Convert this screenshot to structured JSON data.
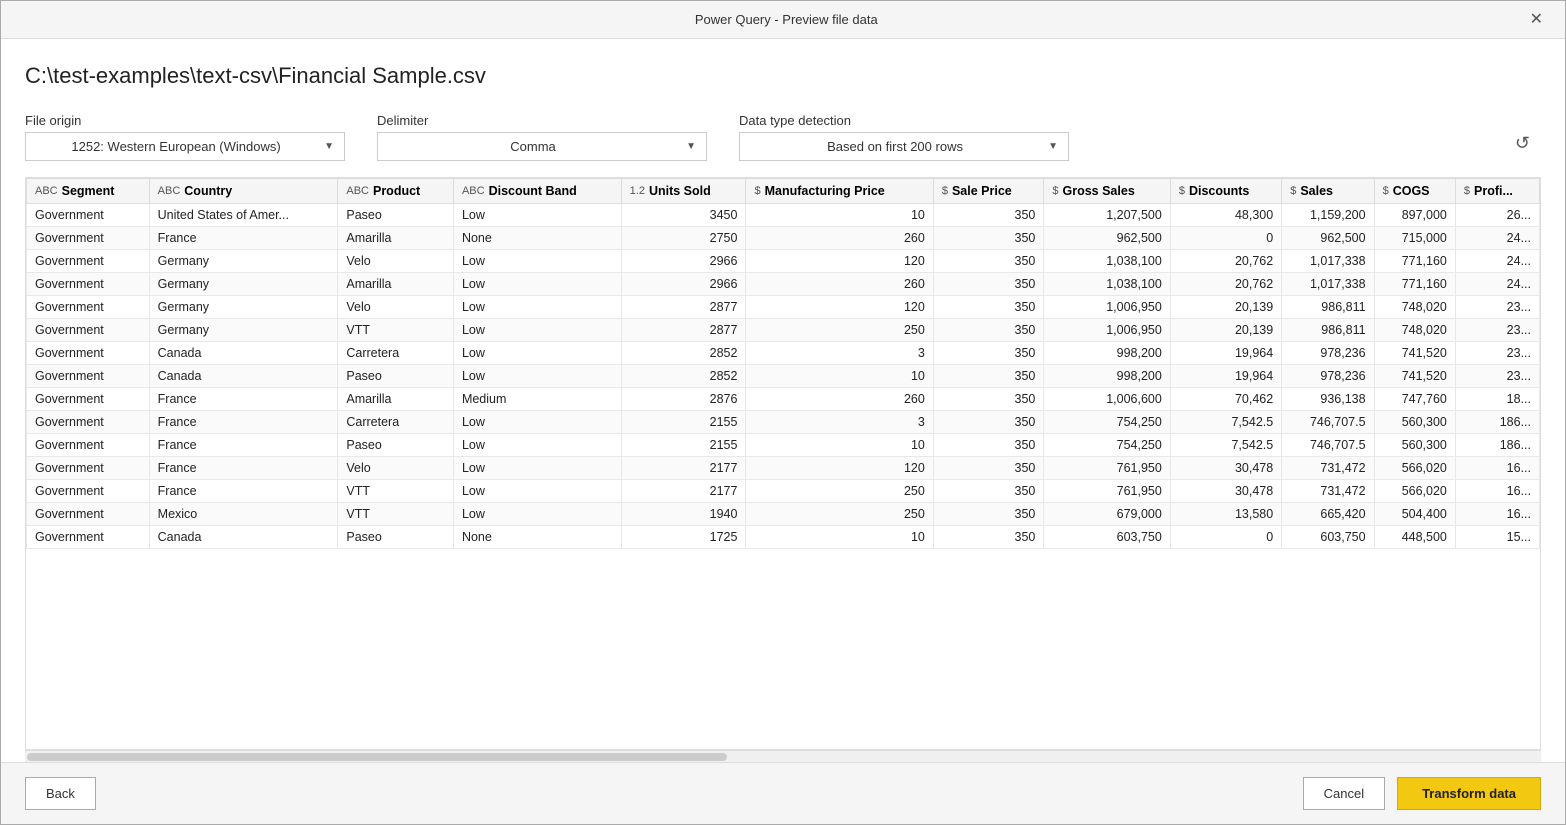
{
  "window": {
    "title": "Power Query - Preview file data",
    "close_label": "✕"
  },
  "file_path": "C:\\test-examples\\text-csv\\Financial Sample.csv",
  "controls": {
    "file_origin_label": "File origin",
    "file_origin_value": "1252: Western European (Windows)",
    "delimiter_label": "Delimiter",
    "delimiter_value": "Comma",
    "detection_label": "Data type detection",
    "detection_value": "Based on first 200 rows"
  },
  "table": {
    "columns": [
      {
        "id": "segment",
        "label": "Segment",
        "type": "ABC"
      },
      {
        "id": "country",
        "label": "Country",
        "type": "ABC"
      },
      {
        "id": "product",
        "label": "Product",
        "type": "ABC"
      },
      {
        "id": "discount_band",
        "label": "Discount Band",
        "type": "ABC"
      },
      {
        "id": "units_sold",
        "label": "Units Sold",
        "type": "1.2"
      },
      {
        "id": "mfg_price",
        "label": "Manufacturing Price",
        "type": "$"
      },
      {
        "id": "sale_price",
        "label": "Sale Price",
        "type": "$"
      },
      {
        "id": "gross_sales",
        "label": "Gross Sales",
        "type": "$"
      },
      {
        "id": "discounts",
        "label": "Discounts",
        "type": "$"
      },
      {
        "id": "sales",
        "label": "Sales",
        "type": "$"
      },
      {
        "id": "cogs",
        "label": "COGS",
        "type": "$"
      },
      {
        "id": "profit",
        "label": "Profi...",
        "type": "$"
      }
    ],
    "rows": [
      [
        "Government",
        "United States of Amer...",
        "Paseo",
        "Low",
        "3450",
        "10",
        "350",
        "1,207,500",
        "48,300",
        "1,159,200",
        "897,000",
        "26..."
      ],
      [
        "Government",
        "France",
        "Amarilla",
        "None",
        "2750",
        "260",
        "350",
        "962,500",
        "0",
        "962,500",
        "715,000",
        "24..."
      ],
      [
        "Government",
        "Germany",
        "Velo",
        "Low",
        "2966",
        "120",
        "350",
        "1,038,100",
        "20,762",
        "1,017,338",
        "771,160",
        "24..."
      ],
      [
        "Government",
        "Germany",
        "Amarilla",
        "Low",
        "2966",
        "260",
        "350",
        "1,038,100",
        "20,762",
        "1,017,338",
        "771,160",
        "24..."
      ],
      [
        "Government",
        "Germany",
        "Velo",
        "Low",
        "2877",
        "120",
        "350",
        "1,006,950",
        "20,139",
        "986,811",
        "748,020",
        "23..."
      ],
      [
        "Government",
        "Germany",
        "VTT",
        "Low",
        "2877",
        "250",
        "350",
        "1,006,950",
        "20,139",
        "986,811",
        "748,020",
        "23..."
      ],
      [
        "Government",
        "Canada",
        "Carretera",
        "Low",
        "2852",
        "3",
        "350",
        "998,200",
        "19,964",
        "978,236",
        "741,520",
        "23..."
      ],
      [
        "Government",
        "Canada",
        "Paseo",
        "Low",
        "2852",
        "10",
        "350",
        "998,200",
        "19,964",
        "978,236",
        "741,520",
        "23..."
      ],
      [
        "Government",
        "France",
        "Amarilla",
        "Medium",
        "2876",
        "260",
        "350",
        "1,006,600",
        "70,462",
        "936,138",
        "747,760",
        "18..."
      ],
      [
        "Government",
        "France",
        "Carretera",
        "Low",
        "2155",
        "3",
        "350",
        "754,250",
        "7,542.5",
        "746,707.5",
        "560,300",
        "186..."
      ],
      [
        "Government",
        "France",
        "Paseo",
        "Low",
        "2155",
        "10",
        "350",
        "754,250",
        "7,542.5",
        "746,707.5",
        "560,300",
        "186..."
      ],
      [
        "Government",
        "France",
        "Velo",
        "Low",
        "2177",
        "120",
        "350",
        "761,950",
        "30,478",
        "731,472",
        "566,020",
        "16..."
      ],
      [
        "Government",
        "France",
        "VTT",
        "Low",
        "2177",
        "250",
        "350",
        "761,950",
        "30,478",
        "731,472",
        "566,020",
        "16..."
      ],
      [
        "Government",
        "Mexico",
        "VTT",
        "Low",
        "1940",
        "250",
        "350",
        "679,000",
        "13,580",
        "665,420",
        "504,400",
        "16..."
      ],
      [
        "Government",
        "Canada",
        "Paseo",
        "None",
        "1725",
        "10",
        "350",
        "603,750",
        "0",
        "603,750",
        "448,500",
        "15..."
      ]
    ]
  },
  "footer": {
    "back_label": "Back",
    "cancel_label": "Cancel",
    "transform_label": "Transform data"
  }
}
